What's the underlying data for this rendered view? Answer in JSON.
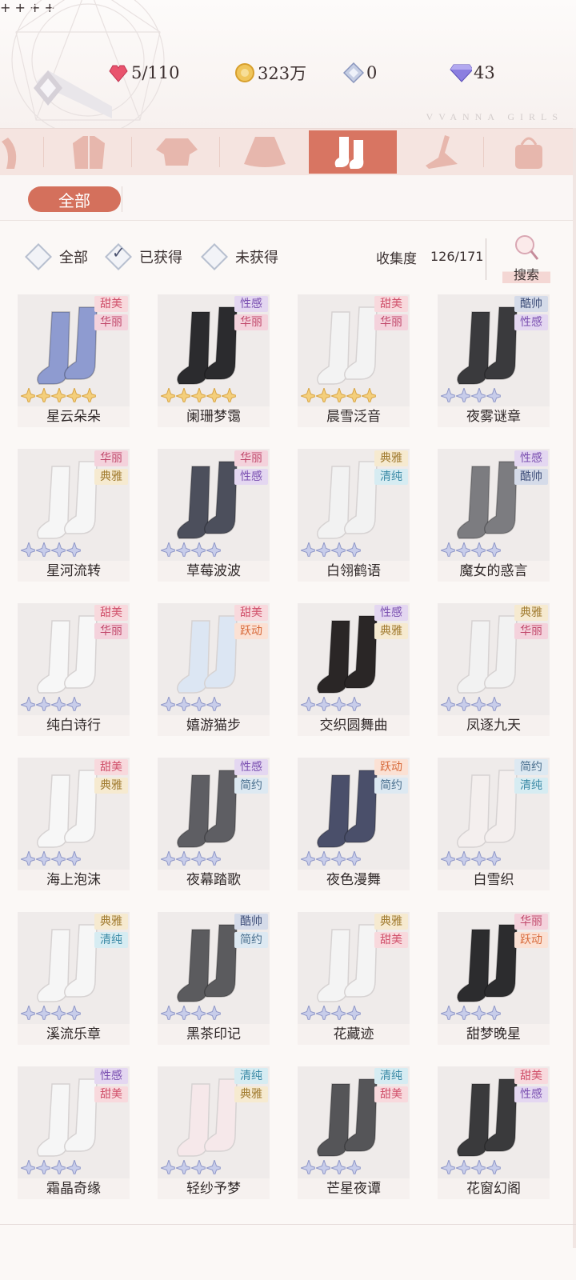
{
  "resources": {
    "hearts": "5/110",
    "gold": "323万",
    "crystal": "0",
    "diamond": "43"
  },
  "brand": "VVANNA GIRLS",
  "categories": [
    "hair",
    "coat",
    "top",
    "skirt",
    "socks",
    "shoes",
    "bag"
  ],
  "active_category": "socks",
  "sub_tab": "全部",
  "filters": [
    "全部",
    "已获得",
    "未获得"
  ],
  "collection": {
    "label": "收集度",
    "value": "126/171"
  },
  "search_label": "搜索",
  "tag_colors": {
    "甜美": {
      "bg": "#f8d9dd",
      "fg": "#d0506a"
    },
    "华丽": {
      "bg": "#f4d2dc",
      "fg": "#c0476a"
    },
    "性感": {
      "bg": "#e4d7f1",
      "fg": "#7a4fb0"
    },
    "酷帅": {
      "bg": "#d5dbe9",
      "fg": "#3f4f7a"
    },
    "典雅": {
      "bg": "#f6ead0",
      "fg": "#a07a2e"
    },
    "清纯": {
      "bg": "#d6ecf2",
      "fg": "#3c8aa6"
    },
    "跃动": {
      "bg": "#fbe1d4",
      "fg": "#d76a3b"
    },
    "简约": {
      "bg": "#dde9f2",
      "fg": "#4a6f8e"
    }
  },
  "items": [
    {
      "name": "星云朵朵",
      "tags": [
        "甜美",
        "华丽"
      ],
      "stars": 5,
      "star_color": "gold",
      "sock_color": "#8e9bd0"
    },
    {
      "name": "阑珊梦霭",
      "tags": [
        "性感",
        "华丽"
      ],
      "stars": 5,
      "star_color": "gold",
      "sock_color": "#2b2b2e"
    },
    {
      "name": "晨雪泛音",
      "tags": [
        "甜美",
        "华丽"
      ],
      "stars": 5,
      "star_color": "gold",
      "sock_color": "#f3f3f3"
    },
    {
      "name": "夜雾谜章",
      "tags": [
        "酷帅",
        "性感"
      ],
      "stars": 4,
      "star_color": "blue",
      "sock_color": "#3a3a3d"
    },
    {
      "name": "星河流转",
      "tags": [
        "华丽",
        "典雅"
      ],
      "stars": 4,
      "star_color": "blue",
      "sock_color": "#f6f6f6"
    },
    {
      "name": "草莓波波",
      "tags": [
        "华丽",
        "性感"
      ],
      "stars": 4,
      "star_color": "blue",
      "sock_color": "#4c4f5c"
    },
    {
      "name": "白翎鹤语",
      "tags": [
        "典雅",
        "清纯"
      ],
      "stars": 4,
      "star_color": "blue",
      "sock_color": "#f2f2f2"
    },
    {
      "name": "魔女的惑言",
      "tags": [
        "性感",
        "酷帅"
      ],
      "stars": 4,
      "star_color": "blue",
      "sock_color": "#7c7c80"
    },
    {
      "name": "纯白诗行",
      "tags": [
        "甜美",
        "华丽"
      ],
      "stars": 4,
      "star_color": "blue",
      "sock_color": "#f7f7f7"
    },
    {
      "name": "嬉游猫步",
      "tags": [
        "甜美",
        "跃动"
      ],
      "stars": 4,
      "star_color": "blue",
      "sock_color": "#dce6f3"
    },
    {
      "name": "交织圆舞曲",
      "tags": [
        "性感",
        "典雅"
      ],
      "stars": 4,
      "star_color": "blue",
      "sock_color": "#2a2626"
    },
    {
      "name": "凤逐九天",
      "tags": [
        "典雅",
        "华丽"
      ],
      "stars": 4,
      "star_color": "blue",
      "sock_color": "#f2f2f2"
    },
    {
      "name": "海上泡沫",
      "tags": [
        "甜美",
        "典雅"
      ],
      "stars": 4,
      "star_color": "blue",
      "sock_color": "#f7f7f7"
    },
    {
      "name": "夜幕踏歌",
      "tags": [
        "性感",
        "简约"
      ],
      "stars": 4,
      "star_color": "blue",
      "sock_color": "#5e5e63"
    },
    {
      "name": "夜色漫舞",
      "tags": [
        "跃动",
        "简约"
      ],
      "stars": 4,
      "star_color": "blue",
      "sock_color": "#4a4f6a"
    },
    {
      "name": "白雪织",
      "tags": [
        "简约",
        "清纯"
      ],
      "stars": 4,
      "star_color": "blue",
      "sock_color": "#f4efee"
    },
    {
      "name": "溪流乐章",
      "tags": [
        "典雅",
        "清纯"
      ],
      "stars": 4,
      "star_color": "blue",
      "sock_color": "#f6f6f6"
    },
    {
      "name": "黑茶印记",
      "tags": [
        "酷帅",
        "简约"
      ],
      "stars": 4,
      "star_color": "blue",
      "sock_color": "#5b5b5e"
    },
    {
      "name": "花藏迹",
      "tags": [
        "典雅",
        "甜美"
      ],
      "stars": 4,
      "star_color": "blue",
      "sock_color": "#f4f4f4"
    },
    {
      "name": "甜梦晚星",
      "tags": [
        "华丽",
        "跃动"
      ],
      "stars": 4,
      "star_color": "blue",
      "sock_color": "#2c2c2e"
    },
    {
      "name": "霜晶奇缘",
      "tags": [
        "性感",
        "甜美"
      ],
      "stars": 4,
      "star_color": "blue",
      "sock_color": "#f6f6f6"
    },
    {
      "name": "轻纱予梦",
      "tags": [
        "清纯",
        "典雅"
      ],
      "stars": 4,
      "star_color": "blue",
      "sock_color": "#f6e8ea"
    },
    {
      "name": "芒星夜谭",
      "tags": [
        "清纯",
        "甜美"
      ],
      "stars": 4,
      "star_color": "blue",
      "sock_color": "#555558"
    },
    {
      "name": "花窗幻阁",
      "tags": [
        "甜美",
        "性感"
      ],
      "stars": 4,
      "star_color": "blue",
      "sock_color": "#3a3a3c"
    }
  ]
}
